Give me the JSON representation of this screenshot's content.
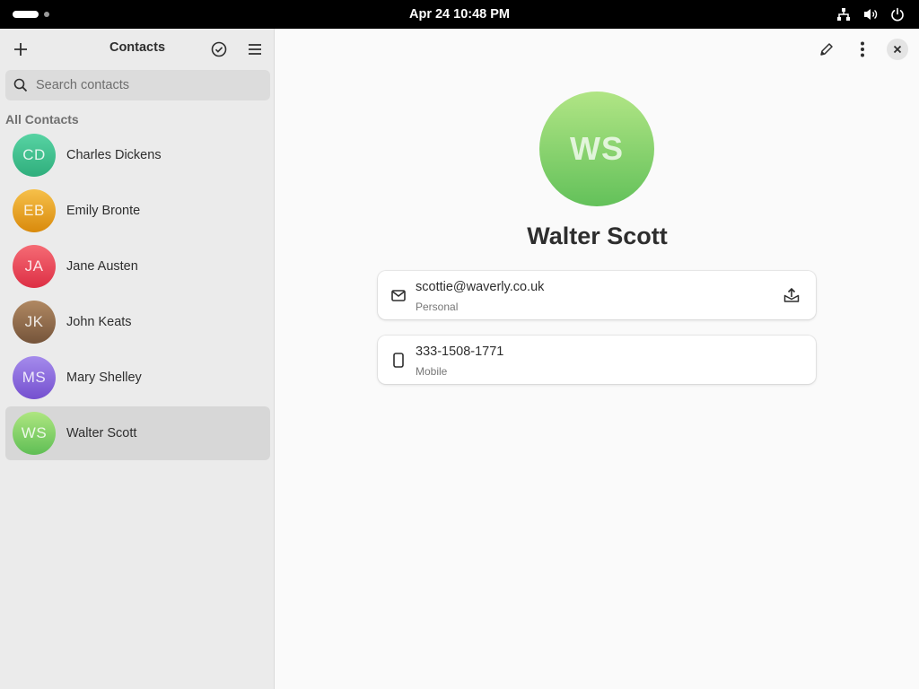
{
  "topbar": {
    "clock": "Apr 24  10:48 PM"
  },
  "sidebar": {
    "title": "Contacts",
    "search_placeholder": "Search contacts",
    "section_label": "All Contacts",
    "contacts": [
      {
        "initials": "CD",
        "name": "Charles Dickens",
        "color": "#3ec08f"
      },
      {
        "initials": "EB",
        "name": "Emily Bronte",
        "color": "#e8a21f"
      },
      {
        "initials": "JA",
        "name": "Jane Austen",
        "color": "#e9495a"
      },
      {
        "initials": "JK",
        "name": "John Keats",
        "color": "#8d6748"
      },
      {
        "initials": "MS",
        "name": "Mary Shelley",
        "color": "#8a67d8"
      },
      {
        "initials": "WS",
        "name": "Walter Scott",
        "color": "#82cf64"
      }
    ],
    "selected_index": 5
  },
  "detail": {
    "initials": "WS",
    "name": "Walter Scott",
    "email": {
      "value": "scottie@waverly.co.uk",
      "type": "Personal"
    },
    "phone": {
      "value": "333-1508-1771",
      "type": "Mobile"
    }
  },
  "icons": {
    "add": "plus-icon",
    "select": "check-circle-icon",
    "menu": "hamburger-menu-icon",
    "search": "search-icon",
    "edit": "pencil-icon",
    "more": "more-vertical-icon",
    "close": "close-icon",
    "email": "mail-icon",
    "phone": "phone-icon",
    "send": "send-mail-icon"
  }
}
